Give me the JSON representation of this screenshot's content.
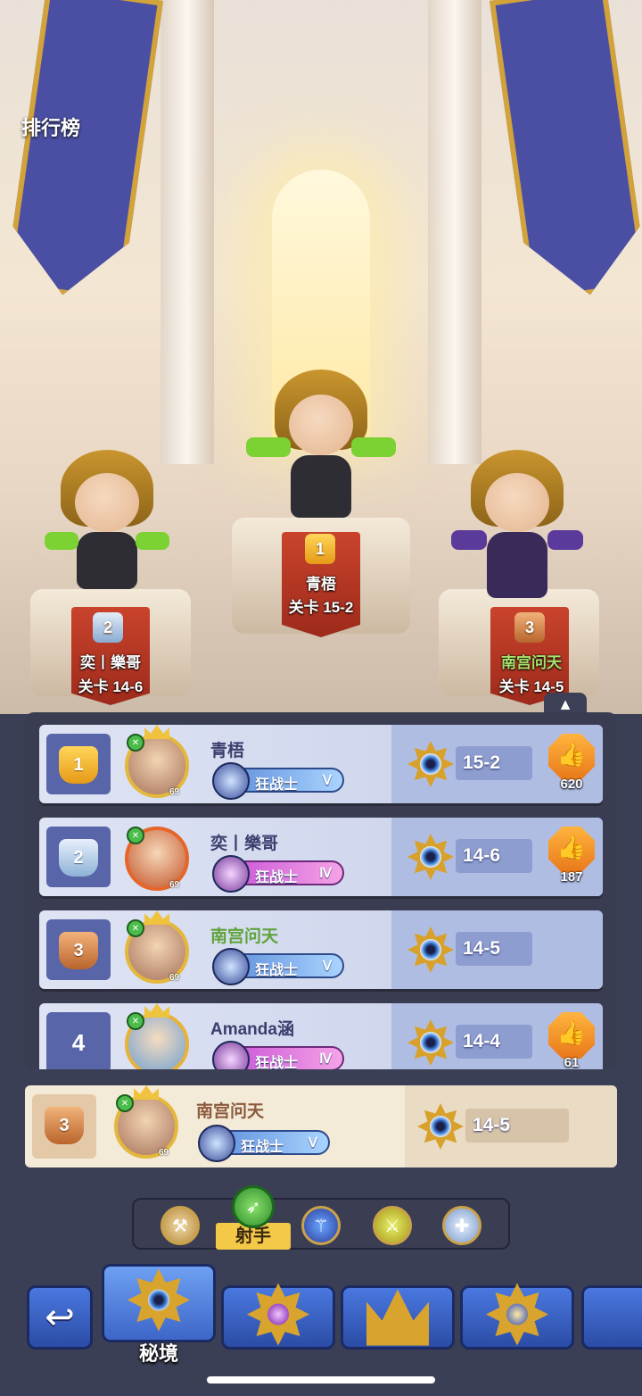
{
  "screen": {
    "title": "排行榜"
  },
  "podium": [
    {
      "rank": "2",
      "name": "奕丨樂哥",
      "stage": "关卡 14-6"
    },
    {
      "rank": "1",
      "name": "青梧",
      "stage": "关卡 15-2"
    },
    {
      "rank": "3",
      "name": "南宫问天",
      "stage": "关卡 14-5",
      "name_color": "#a8e26a"
    }
  ],
  "leaderboard": {
    "rows": [
      {
        "rank": "1",
        "rank_style": "gold",
        "name": "青梧",
        "level": "69",
        "class": "狂战士",
        "tier": "Ⅴ",
        "stage": "15-2",
        "likes": "620"
      },
      {
        "rank": "2",
        "rank_style": "silver",
        "name": "奕丨樂哥",
        "level": "69",
        "class": "狂战士",
        "tier": "Ⅳ",
        "stage": "14-6",
        "likes": "187"
      },
      {
        "rank": "3",
        "rank_style": "bronze",
        "name": "南宫问天",
        "level": "69",
        "class": "狂战士",
        "tier": "Ⅴ",
        "stage": "14-5",
        "likes": ""
      },
      {
        "rank": "4",
        "rank_style": "plain",
        "name": "Amanda涵",
        "level": "",
        "class": "狂战士",
        "tier": "Ⅳ",
        "stage": "14-4",
        "likes": "61"
      }
    ],
    "self": {
      "rank": "3",
      "name": "南宫问天",
      "level": "69",
      "class": "狂战士",
      "tier": "Ⅴ",
      "stage": "14-5"
    }
  },
  "class_filter": {
    "items": [
      "axe-icon",
      "bow-icon",
      "staff-icon",
      "sword-icon",
      "cross-icon"
    ],
    "active_label": "射手"
  },
  "bottom_nav": {
    "items": [
      "back-icon",
      "秘境",
      "purple-gem-emblem",
      "crown-emblem",
      "star-emblem"
    ],
    "active_label": "秘境"
  },
  "colors": {
    "accent_gold": "#e59a16",
    "panel": "#3a3d52",
    "nav_blue": "#2b4ca6"
  }
}
